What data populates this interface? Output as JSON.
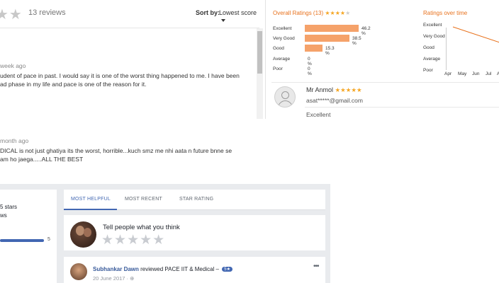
{
  "reviews_header": {
    "stars": "★★",
    "count": "13 reviews",
    "sort_label": "Sort by:",
    "sort_value": "Lowest score"
  },
  "reviews": [
    {
      "time": "week ago",
      "text": "udent of pace in past. I would say it is one of the worst thing happened to me. I have been\nad phase in my life and pace is one of the reason for it."
    },
    {
      "time": "month ago",
      "text": "DICAL is not just ghatiya its the worst, horrible...kuch smz me nhi aata n future bnne se\nam ho jaega.....ALL THE BEST"
    }
  ],
  "overall": {
    "title": "Overall Ratings (13)",
    "stars_filled": "★★★★",
    "stars_empty": "★",
    "rows": [
      {
        "label": "Excellent",
        "pct": "46.2 %",
        "value": 46.2
      },
      {
        "label": "Very Good",
        "pct": "38.5 %",
        "value": 38.5
      },
      {
        "label": "Good",
        "pct": "15.3 %",
        "value": 15.3
      },
      {
        "label": "Average",
        "pct": "0 %",
        "value": 0
      },
      {
        "label": "Poor",
        "pct": "0 %",
        "value": 0
      }
    ]
  },
  "over_time": {
    "title": "Ratings over time",
    "levels": [
      "Excellent",
      "Very Good",
      "Good",
      "Average",
      "Poor"
    ],
    "months": [
      "Apr",
      "May",
      "Jun",
      "Jul",
      "A"
    ]
  },
  "reviewer": {
    "name": "Mr Anmol",
    "stars": "★★★★★",
    "email": "asat*****@gmail.com",
    "rating_text": "Excellent"
  },
  "fb": {
    "summary_line1": "5 stars",
    "summary_line2": "ws",
    "bar_value": "5",
    "tabs": [
      "MOST HELPFUL",
      "MOST RECENT",
      "STAR RATING"
    ],
    "compose_prompt": "Tell people what you think",
    "compose_stars": "★★★★★",
    "post": {
      "name": "Subhankar Dawn",
      "action": "reviewed PACE IIT & Medical –",
      "badge": "5★",
      "date": "20 June 2017 · ",
      "globe": "⊕"
    },
    "more": "•••"
  },
  "colors": {
    "accent_orange": "#e8711c",
    "bar_orange": "#f5a26a",
    "star_gold": "#f5a623",
    "fb_blue": "#4267b2"
  }
}
